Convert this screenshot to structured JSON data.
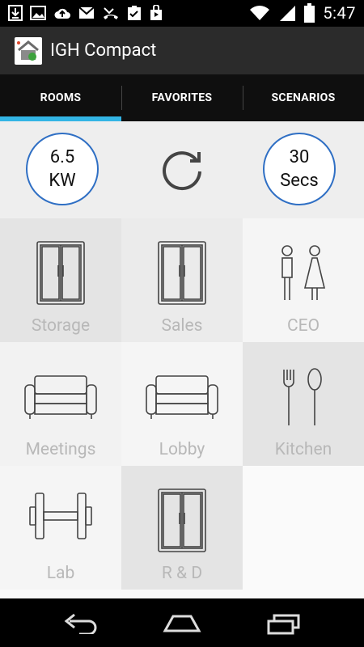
{
  "status": {
    "time": "5:47"
  },
  "app": {
    "title": "IGH Compact"
  },
  "tabs": [
    {
      "label": "ROOMS",
      "active": true
    },
    {
      "label": "FAVORITES",
      "active": false
    },
    {
      "label": "SCENARIOS",
      "active": false
    }
  ],
  "power": {
    "value": "6.5",
    "unit": "KW"
  },
  "timer": {
    "value": "30",
    "unit": "Secs"
  },
  "rooms": [
    {
      "label": "Storage",
      "icon": "door-icon"
    },
    {
      "label": "Sales",
      "icon": "door-icon"
    },
    {
      "label": "CEO",
      "icon": "restroom-icon"
    },
    {
      "label": "Meetings",
      "icon": "sofa-icon"
    },
    {
      "label": "Lobby",
      "icon": "sofa-icon"
    },
    {
      "label": "Kitchen",
      "icon": "fork-spoon-icon"
    },
    {
      "label": "Lab",
      "icon": "dumbbell-icon"
    },
    {
      "label": "R & D",
      "icon": "door-icon"
    }
  ],
  "colors": {
    "accent": "#33b5e5",
    "circle_border": "#2f6fc4",
    "label": "#b8b8b8"
  }
}
